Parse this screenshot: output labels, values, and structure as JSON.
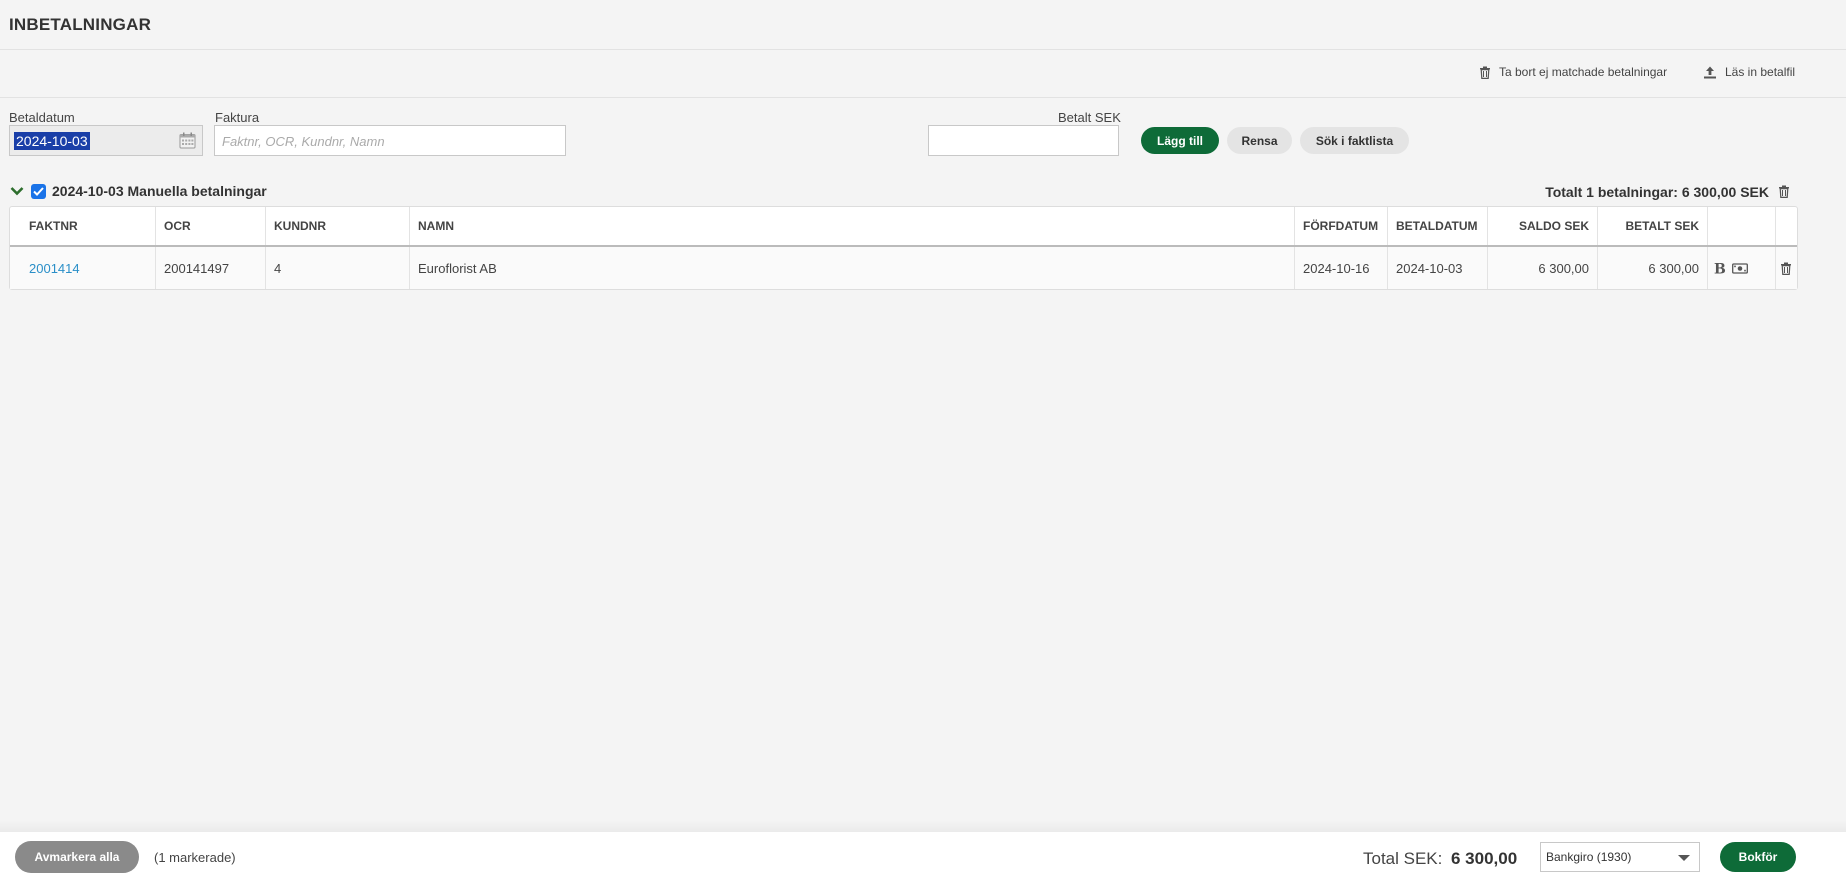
{
  "header": {
    "title": "INBETALNINGAR"
  },
  "actions": {
    "delete_unmatched_label": "Ta bort ej matchade betalningar",
    "upload_file_label": "Läs in betalfil"
  },
  "form": {
    "date_label": "Betaldatum",
    "date_value": "2024-10-03",
    "invoice_label": "Faktura",
    "invoice_placeholder": "Faktnr, OCR, Kundnr, Namn",
    "paid_label": "Betalt SEK",
    "paid_value": "",
    "add_label": "Lägg till",
    "clear_label": "Rensa",
    "search_label": "Sök i faktlista"
  },
  "group": {
    "title": "2024-10-03 Manuella betalningar",
    "total": "Totalt 1 betalningar: 6 300,00 SEK",
    "checked": true
  },
  "table": {
    "columns": {
      "faktnr": "FAKTNR",
      "ocr": "OCR",
      "kundnr": "KUNDNR",
      "namn": "NAMN",
      "forfdatum": "FÖRFDATUM",
      "betaldatum": "BETALDATUM",
      "saldo": "SALDO SEK",
      "betalt": "BETALT SEK"
    },
    "rows": [
      {
        "faktnr": "2001414",
        "ocr": "200141497",
        "kundnr": "4",
        "namn": "Euroflorist AB",
        "forfdatum": "2024-10-16",
        "betaldatum": "2024-10-03",
        "saldo": "6 300,00",
        "betalt": "6 300,00"
      }
    ]
  },
  "footer": {
    "unmark_all_label": "Avmarkera alla",
    "marked_count": "(1 markerade)",
    "total_label": "Total SEK:",
    "total_value": "6 300,00",
    "account_selected": "Bankgiro (1930)",
    "book_label": "Bokför"
  },
  "colors": {
    "primary_green": "#0e6b38",
    "link_blue": "#2a8fc8",
    "checkbox_blue": "#1a73e8"
  }
}
